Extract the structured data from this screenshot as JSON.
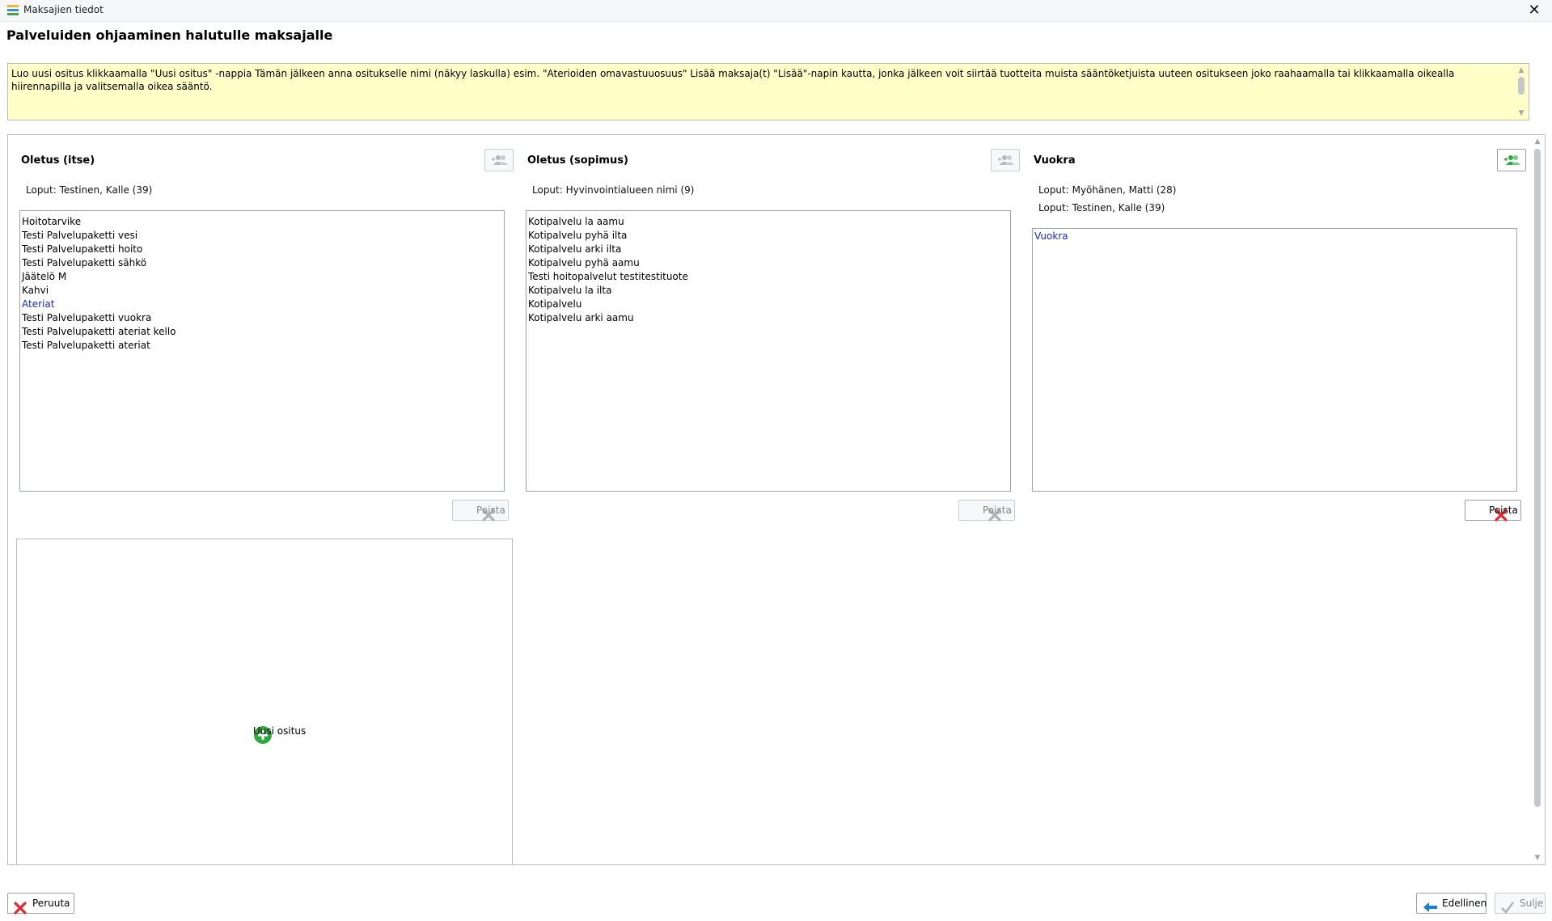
{
  "window": {
    "title": "Maksajien tiedot",
    "close_glyph": "✕"
  },
  "heading": "Palveluiden ohjaaminen halutulle maksajalle",
  "info_text": "Luo uusi ositus klikkaamalla \"Uusi ositus\" -nappia Tämän jälkeen anna ositukselle nimi (näkyy laskulla) esim. \"Aterioiden omavastuuosuus\" Lisää maksaja(t) \"Lisää\"-napin kautta, jonka jälkeen voit siirtää tuotteita muista sääntöketjuista uuteen ositukseen joko raahaamalla tai klikkaamalla oikealla hiirennapilla ja valitsemalla oikea sääntö.",
  "columns": [
    {
      "title": "Oletus (itse)",
      "payers": [
        "Loput: Testinen, Kalle (39)"
      ],
      "items": [
        {
          "text": "Hoitotarvike",
          "highlight": false
        },
        {
          "text": "Testi Palvelupaketti vesi",
          "highlight": false
        },
        {
          "text": "Testi Palvelupaketti hoito",
          "highlight": false
        },
        {
          "text": "Testi Palvelupaketti sähkö",
          "highlight": false
        },
        {
          "text": "Jäätelö M",
          "highlight": false
        },
        {
          "text": "Kahvi",
          "highlight": false
        },
        {
          "text": "Ateriat",
          "highlight": true
        },
        {
          "text": "Testi Palvelupaketti vuokra",
          "highlight": false
        },
        {
          "text": "Testi Palvelupaketti ateriat kello",
          "highlight": false
        },
        {
          "text": "Testi Palvelupaketti ateriat",
          "highlight": false
        }
      ],
      "delete_label": "Poista",
      "delete_enabled": false,
      "assign_enabled": false
    },
    {
      "title": "Oletus (sopimus)",
      "payers": [
        "Loput: Hyvinvointialueen nimi (9)"
      ],
      "items": [
        {
          "text": "Kotipalvelu la aamu",
          "highlight": false
        },
        {
          "text": "Kotipalvelu pyhä ilta",
          "highlight": false
        },
        {
          "text": "Kotipalvelu arki ilta",
          "highlight": false
        },
        {
          "text": "Kotipalvelu pyhä aamu",
          "highlight": false
        },
        {
          "text": "Testi hoitopalvelut testitestituote",
          "highlight": false
        },
        {
          "text": "Kotipalvelu la ilta",
          "highlight": false
        },
        {
          "text": "Kotipalvelu",
          "highlight": false
        },
        {
          "text": "Kotipalvelu arki aamu",
          "highlight": false
        }
      ],
      "delete_label": "Poista",
      "delete_enabled": false,
      "assign_enabled": false
    },
    {
      "title": "Vuokra",
      "payers": [
        "Loput: Myöhänen, Matti (28)",
        "Loput: Testinen, Kalle (39)"
      ],
      "items": [
        {
          "text": "Vuokra",
          "highlight": true
        }
      ],
      "delete_label": "Poista",
      "delete_enabled": true,
      "assign_enabled": true
    }
  ],
  "new_split_label": "Uusi ositus",
  "footer": {
    "cancel_label": "Peruuta",
    "back_label": "Edellinen",
    "close_label": "Sulje"
  },
  "colors": {
    "info_bg": "#ffffc8",
    "highlight_text": "#1a28c8",
    "cancel_red": "#e8262d",
    "add_green": "#2eaa3c",
    "back_blue": "#1b7fd6"
  },
  "icons": {
    "app": "app-stack-icon",
    "assign": "add-users-icon",
    "delete": "x-delete-icon",
    "new": "plus-circle-icon",
    "back": "arrow-left-icon",
    "close": "checkmark-icon"
  }
}
